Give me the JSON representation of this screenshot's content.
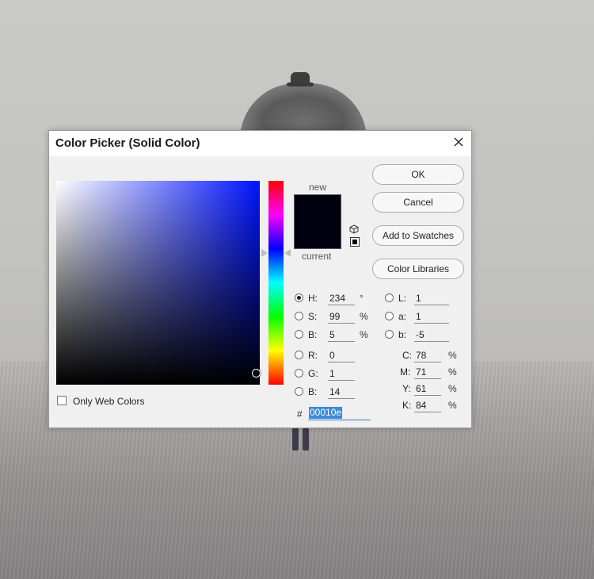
{
  "dialog": {
    "title": "Color Picker (Solid Color)",
    "buttons": {
      "ok": "OK",
      "cancel": "Cancel",
      "add_to_swatches": "Add to Swatches",
      "color_libraries": "Color Libraries"
    },
    "swatch": {
      "new_label": "new",
      "current_label": "current",
      "new_color": "#00010e",
      "current_color": "#00010e"
    },
    "hsb": {
      "h": {
        "label": "H:",
        "value": "234",
        "unit": "°",
        "selected": true
      },
      "s": {
        "label": "S:",
        "value": "99",
        "unit": "%",
        "selected": false
      },
      "b": {
        "label": "B:",
        "value": "5",
        "unit": "%",
        "selected": false
      }
    },
    "rgb": {
      "r": {
        "label": "R:",
        "value": "0"
      },
      "g": {
        "label": "G:",
        "value": "1"
      },
      "b": {
        "label": "B:",
        "value": "14"
      }
    },
    "lab": {
      "l": {
        "label": "L:",
        "value": "1"
      },
      "a": {
        "label": "a:",
        "value": "1"
      },
      "b": {
        "label": "b:",
        "value": "-5"
      }
    },
    "cmyk": {
      "c": {
        "label": "C:",
        "value": "78",
        "unit": "%"
      },
      "m": {
        "label": "M:",
        "value": "71",
        "unit": "%"
      },
      "y": {
        "label": "Y:",
        "value": "61",
        "unit": "%"
      },
      "k": {
        "label": "K:",
        "value": "84",
        "unit": "%"
      }
    },
    "hex": {
      "prefix": "#",
      "value": "00010e"
    },
    "only_web_colors": {
      "label": "Only Web Colors",
      "checked": false
    },
    "field_hue_color": "#0014ff",
    "icons": [
      "close-icon",
      "cube-icon",
      "web-safe-color-icon"
    ]
  }
}
